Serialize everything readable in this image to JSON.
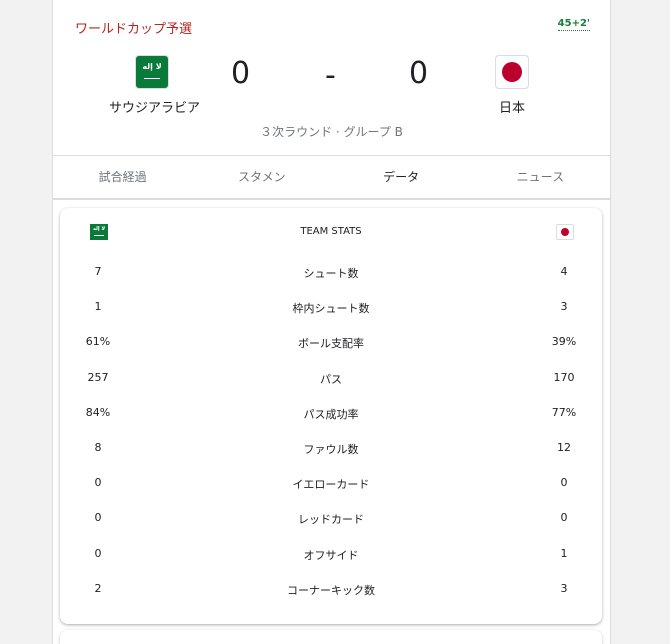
{
  "match": {
    "competition": "ワールドカップ予選",
    "live_minute": "45+2'",
    "round": "３次ラウンド · グループ B",
    "home": {
      "name": "サウジアラビア",
      "score": "0",
      "flag_text": "لا إله"
    },
    "separator": "-",
    "away": {
      "name": "日本",
      "score": "0"
    }
  },
  "tabs": [
    {
      "label": "試合経過"
    },
    {
      "label": "スタメン"
    },
    {
      "label": "データ"
    },
    {
      "label": "ニュース"
    }
  ],
  "active_tab": "データ",
  "stats": {
    "title": "TEAM STATS",
    "rows": [
      {
        "label": "シュート数",
        "home": "7",
        "away": "4"
      },
      {
        "label": "枠内シュート数",
        "home": "1",
        "away": "3"
      },
      {
        "label": "ボール支配率",
        "home": "61%",
        "away": "39%"
      },
      {
        "label": "パス",
        "home": "257",
        "away": "170"
      },
      {
        "label": "パス成功率",
        "home": "84%",
        "away": "77%"
      },
      {
        "label": "ファウル数",
        "home": "8",
        "away": "12"
      },
      {
        "label": "イエローカード",
        "home": "0",
        "away": "0"
      },
      {
        "label": "レッドカード",
        "home": "0",
        "away": "0"
      },
      {
        "label": "オフサイド",
        "home": "0",
        "away": "1"
      },
      {
        "label": "コーナーキック数",
        "home": "2",
        "away": "3"
      }
    ]
  },
  "colors": {
    "competition": "#b3261e",
    "live": "#188038",
    "saudi_green": "#0a7a3b",
    "japan_red": "#bc002d"
  }
}
